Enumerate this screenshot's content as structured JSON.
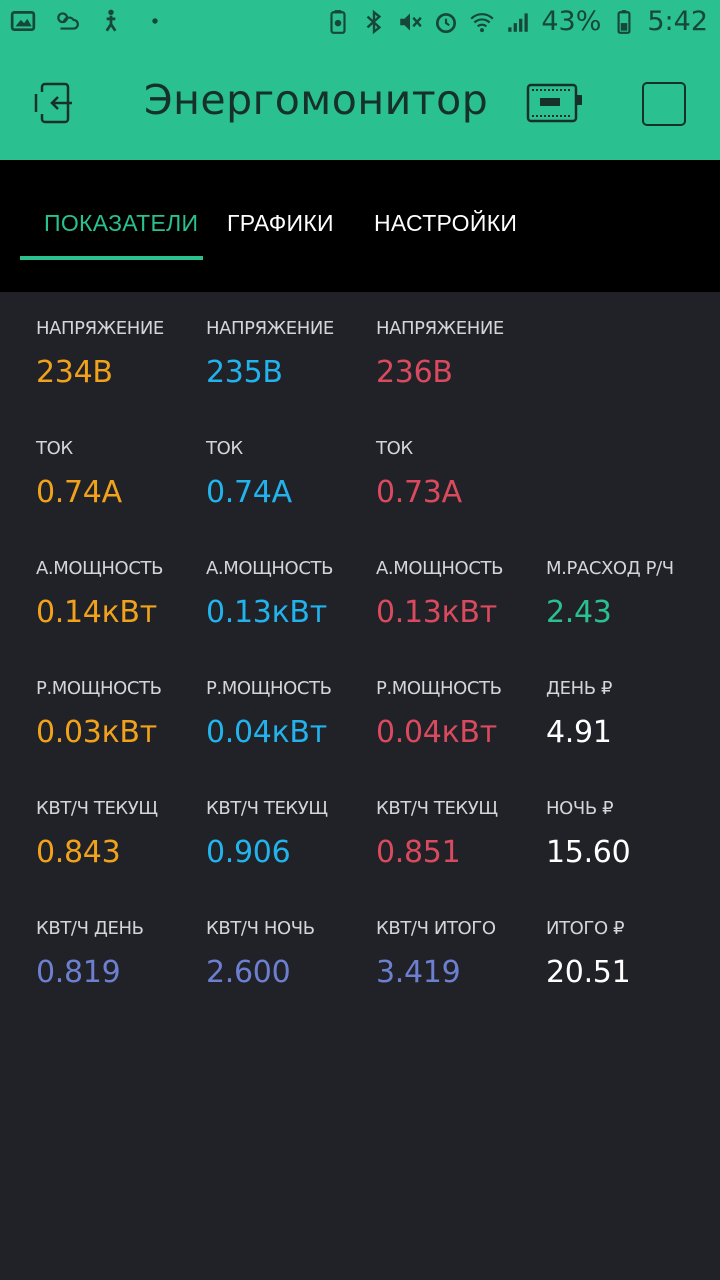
{
  "status_bar": {
    "battery_percent": "43%",
    "time": "5:42",
    "icons_left": [
      "image-icon",
      "weather-icon",
      "figure-icon",
      "dot-icon"
    ],
    "icons_right": [
      "battery-saver-icon",
      "bluetooth-icon",
      "mute-icon",
      "alarm-icon",
      "wifi-icon",
      "signal-icon",
      "battery-icon"
    ]
  },
  "app_bar": {
    "title": "Энергомонитор",
    "colors": {
      "background": "#2ac08f",
      "foreground": "#16302a"
    }
  },
  "tabs": [
    {
      "label": "ПОКАЗАТЕЛИ",
      "active": true
    },
    {
      "label": "ГРАФИКИ",
      "active": false
    },
    {
      "label": "НАСТРОЙКИ",
      "active": false
    }
  ],
  "colors": {
    "phase1": "#f0a21c",
    "phase2": "#22b3ec",
    "phase3": "#d94a5f",
    "accent_green": "#2ac08f",
    "totals_blue": "#6d7fd0",
    "white": "#ffffff"
  },
  "rows": [
    [
      {
        "label": "НАПРЯЖЕНИЕ",
        "value": "234В",
        "color": "phase1"
      },
      {
        "label": "НАПРЯЖЕНИЕ",
        "value": "235В",
        "color": "phase2"
      },
      {
        "label": "НАПРЯЖЕНИЕ",
        "value": "236В",
        "color": "phase3"
      }
    ],
    [
      {
        "label": "ТОК",
        "value": "0.74А",
        "color": "phase1"
      },
      {
        "label": "ТОК",
        "value": "0.74А",
        "color": "phase2"
      },
      {
        "label": "ТОК",
        "value": "0.73А",
        "color": "phase3"
      }
    ],
    [
      {
        "label": "А.МОЩНОСТЬ",
        "value": "0.14кВт",
        "color": "phase1"
      },
      {
        "label": "А.МОЩНОСТЬ",
        "value": "0.13кВт",
        "color": "phase2"
      },
      {
        "label": "А.МОЩНОСТЬ",
        "value": "0.13кВт",
        "color": "phase3"
      },
      {
        "label": "М.РАСХОД Р/Ч",
        "value": "2.43",
        "color": "accent_green"
      }
    ],
    [
      {
        "label": "Р.МОЩНОСТЬ",
        "value": "0.03кВт",
        "color": "phase1"
      },
      {
        "label": "Р.МОЩНОСТЬ",
        "value": "0.04кВт",
        "color": "phase2"
      },
      {
        "label": "Р.МОЩНОСТЬ",
        "value": "0.04кВт",
        "color": "phase3"
      },
      {
        "label": "ДЕНЬ ₽",
        "value": "4.91",
        "color": "white"
      }
    ],
    [
      {
        "label": "КВТ/Ч ТЕКУЩ",
        "value": "0.843",
        "color": "phase1"
      },
      {
        "label": "КВТ/Ч ТЕКУЩ",
        "value": "0.906",
        "color": "phase2"
      },
      {
        "label": "КВТ/Ч ТЕКУЩ",
        "value": "0.851",
        "color": "phase3"
      },
      {
        "label": "НОЧЬ ₽",
        "value": "15.60",
        "color": "white"
      }
    ],
    [
      {
        "label": "КВТ/Ч ДЕНЬ",
        "value": "0.819",
        "color": "totals_blue"
      },
      {
        "label": "КВТ/Ч НОЧЬ",
        "value": "2.600",
        "color": "totals_blue"
      },
      {
        "label": "КВТ/Ч ИТОГО",
        "value": "3.419",
        "color": "totals_blue"
      },
      {
        "label": "ИТОГО ₽",
        "value": "20.51",
        "color": "white"
      }
    ]
  ]
}
